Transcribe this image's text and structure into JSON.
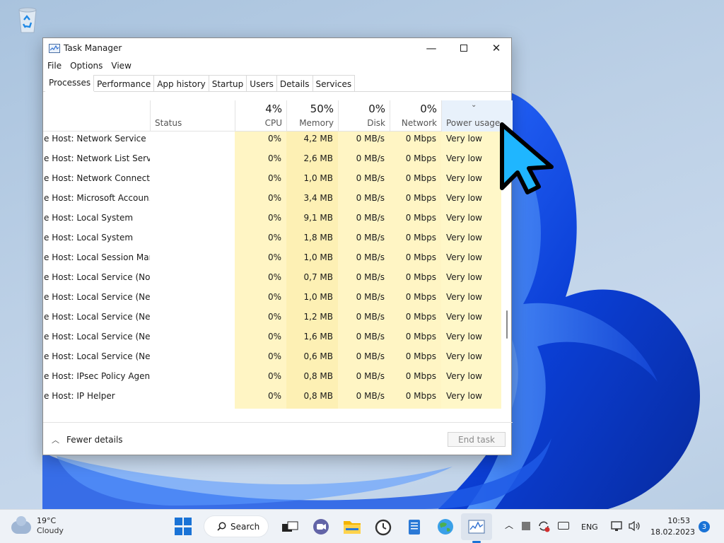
{
  "desktop": {
    "recycle_bin_label": "Recycle Bin"
  },
  "window": {
    "title": "Task Manager",
    "menu": [
      "File",
      "Options",
      "View"
    ],
    "tabs": [
      "Processes",
      "Performance",
      "App history",
      "Startup",
      "Users",
      "Details",
      "Services"
    ],
    "active_tab": "Processes"
  },
  "columns": {
    "status": {
      "label": "Status"
    },
    "cpu": {
      "pct": "4%",
      "label": "CPU"
    },
    "memory": {
      "pct": "50%",
      "label": "Memory"
    },
    "disk": {
      "pct": "0%",
      "label": "Disk"
    },
    "network": {
      "pct": "0%",
      "label": "Network"
    },
    "power": {
      "label": "Power usage",
      "sorted": true
    }
  },
  "rows": [
    {
      "name": "e Host: Network Service",
      "cpu": "0%",
      "memory": "4,2 MB",
      "disk": "0 MB/s",
      "network": "0 Mbps",
      "power": "Very low"
    },
    {
      "name": "e Host: Network List Service",
      "cpu": "0%",
      "memory": "2,6 MB",
      "disk": "0 MB/s",
      "network": "0 Mbps",
      "power": "Very low"
    },
    {
      "name": "e Host: Network Connecti...",
      "cpu": "0%",
      "memory": "1,0 MB",
      "disk": "0 MB/s",
      "network": "0 Mbps",
      "power": "Very low"
    },
    {
      "name": "e Host: Microsoft Accoun...",
      "cpu": "0%",
      "memory": "3,4 MB",
      "disk": "0 MB/s",
      "network": "0 Mbps",
      "power": "Very low"
    },
    {
      "name": "e Host: Local System",
      "cpu": "0%",
      "memory": "9,1 MB",
      "disk": "0 MB/s",
      "network": "0 Mbps",
      "power": "Very low"
    },
    {
      "name": "e Host: Local System",
      "cpu": "0%",
      "memory": "1,8 MB",
      "disk": "0 MB/s",
      "network": "0 Mbps",
      "power": "Very low"
    },
    {
      "name": "e Host: Local Session Man...",
      "cpu": "0%",
      "memory": "1,0 MB",
      "disk": "0 MB/s",
      "network": "0 Mbps",
      "power": "Very low"
    },
    {
      "name": "e Host: Local Service (No ...",
      "cpu": "0%",
      "memory": "0,7 MB",
      "disk": "0 MB/s",
      "network": "0 Mbps",
      "power": "Very low"
    },
    {
      "name": "e Host: Local Service (Net...",
      "cpu": "0%",
      "memory": "1,0 MB",
      "disk": "0 MB/s",
      "network": "0 Mbps",
      "power": "Very low"
    },
    {
      "name": "e Host: Local Service (Net...",
      "cpu": "0%",
      "memory": "1,2 MB",
      "disk": "0 MB/s",
      "network": "0 Mbps",
      "power": "Very low"
    },
    {
      "name": "e Host: Local Service (Net...",
      "cpu": "0%",
      "memory": "1,6 MB",
      "disk": "0 MB/s",
      "network": "0 Mbps",
      "power": "Very low"
    },
    {
      "name": "e Host: Local Service (Net...",
      "cpu": "0%",
      "memory": "0,6 MB",
      "disk": "0 MB/s",
      "network": "0 Mbps",
      "power": "Very low"
    },
    {
      "name": "e Host: IPsec Policy Agent",
      "cpu": "0%",
      "memory": "0,8 MB",
      "disk": "0 MB/s",
      "network": "0 Mbps",
      "power": "Very low"
    },
    {
      "name": "e Host: IP Helper",
      "cpu": "0%",
      "memory": "0,8 MB",
      "disk": "0 MB/s",
      "network": "0 Mbps",
      "power": "Very low"
    }
  ],
  "footer": {
    "fewer_details": "Fewer details",
    "end_task": "End task"
  },
  "taskbar": {
    "weather_temp": "19°C",
    "weather_cond": "Cloudy",
    "search_label": "Search",
    "lang": "ENG",
    "time": "10:53",
    "date": "18.02.2023",
    "notification_count": "3"
  },
  "colors": {
    "accent": "#1a73d6",
    "highlight_col": "#fff5c4",
    "cursor": "#1fb6ff"
  }
}
